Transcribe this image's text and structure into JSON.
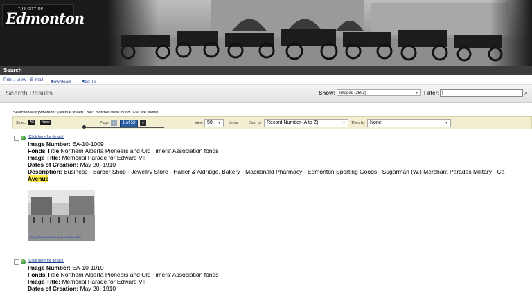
{
  "header": {
    "logo_small": "THE CITY OF",
    "logo_text": "Edmonton"
  },
  "searchbar": {
    "label": "Search"
  },
  "toolbar": {
    "print": "Print / View",
    "email": "E-mail",
    "download": "Download",
    "addto": "Add To"
  },
  "results": {
    "title": "Search Results",
    "show_label": "Show:",
    "show_value": "Images (2603)",
    "filter_label": "Filter:",
    "filter_value": "",
    "info": "Searched everywhere for '(avenue street)'. 2603 matches were found. 1-50 are shown."
  },
  "controls": {
    "select_label": "Select",
    "select_all": "All",
    "select_none": "None",
    "page_label": "Page",
    "page_current": "1 of 53",
    "view_label": "View",
    "view_value": "50",
    "items_label": "items",
    "sortby_label": "Sort by",
    "sortby_value": "Record Number (A to Z)",
    "thenby_label": "Then by",
    "thenby_value": "None"
  },
  "records": [
    {
      "link": "[Click here for details]",
      "image_number_label": "Image Number:",
      "image_number": "EA-10-1009",
      "fonds_label": "Fonds Title",
      "fonds": "Northern Alberta Pioneers and Old Timers' Association fonds",
      "title_label": "Image Title:",
      "title": "Memorial Parade for Edward VII",
      "dates_label": "Dates of Creation:",
      "dates": "May 20, 1910",
      "desc_label": "Description:",
      "desc": "Business - Barber Shop - Jewellry Store - Hallier & Aldridge, Bakery - Macdonald Pharmacy - Edmonton Sporting Goods - Sugarman (W.) Merchant Parades Military - Ca",
      "desc_highlight": "Avenue",
      "thumb_caption": "City of Edmonton Archives EA-10-1009"
    },
    {
      "link": "[Click here for details]",
      "image_number_label": "Image Number:",
      "image_number": "EA-10-1010",
      "fonds_label": "Fonds Title",
      "fonds": "Northern Alberta Pioneers and Old Timers' Association fonds",
      "title_label": "Image Title:",
      "title": "Memorial Parade for Edward VII",
      "dates_label": "Dates of Creation:",
      "dates": "May 20, 1910"
    }
  ]
}
